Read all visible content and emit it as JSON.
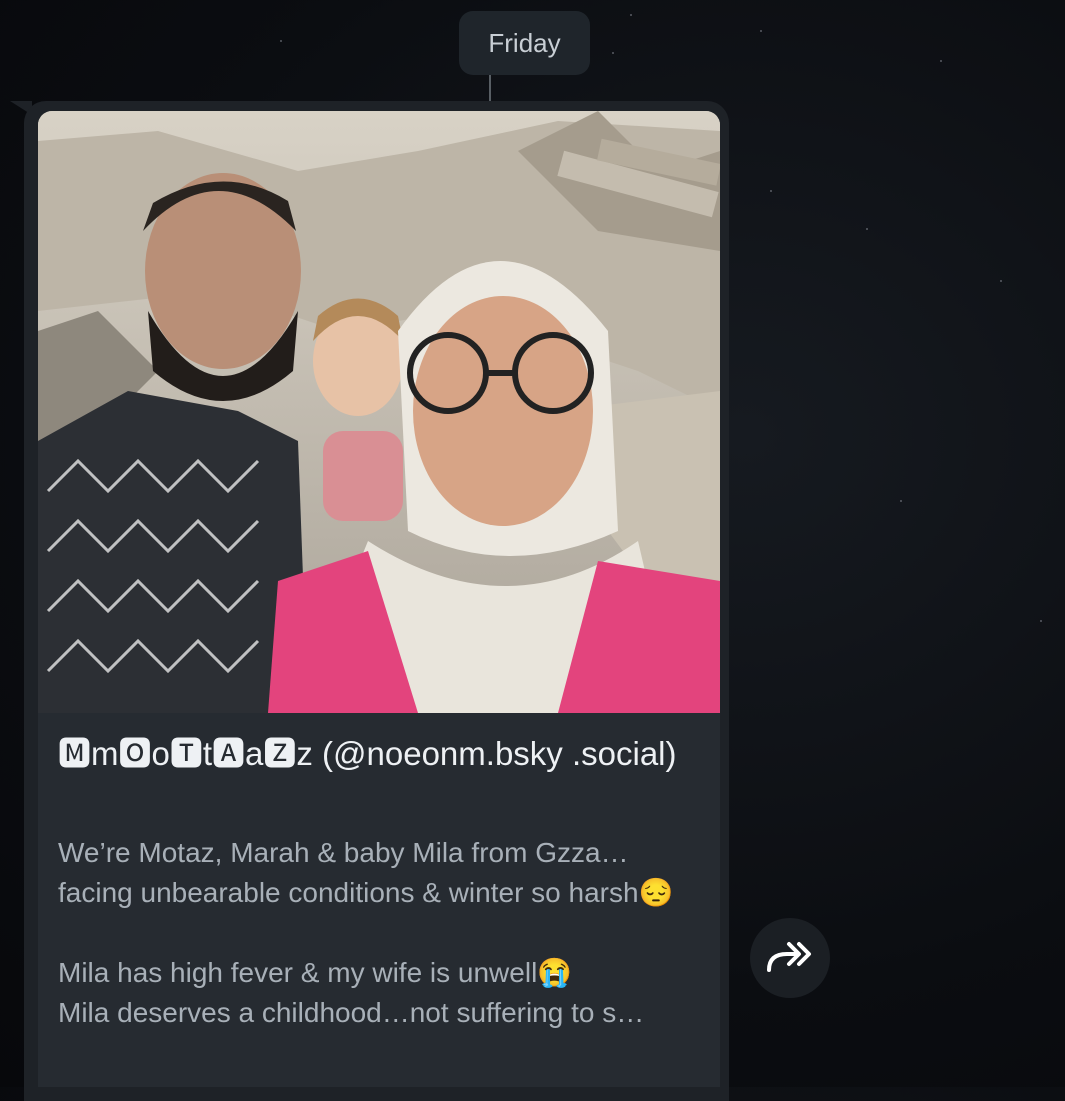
{
  "date_separator": "Friday",
  "link_preview": {
    "title": "🅼m🅾o🆃t🅰a🆉z (@noeonm.bsky .social)",
    "description": "We’re Motaz, Marah & baby Mila from Gzza… facing unbearable conditions & winter so harsh😔\n\nMila has high fever & my wife is unwell😭\nMila deserves a childhood…not suffering to s…"
  },
  "forward_button": {
    "icon": "forward-double-arrow-icon"
  },
  "photo": {
    "icon": "photo-preview"
  }
}
